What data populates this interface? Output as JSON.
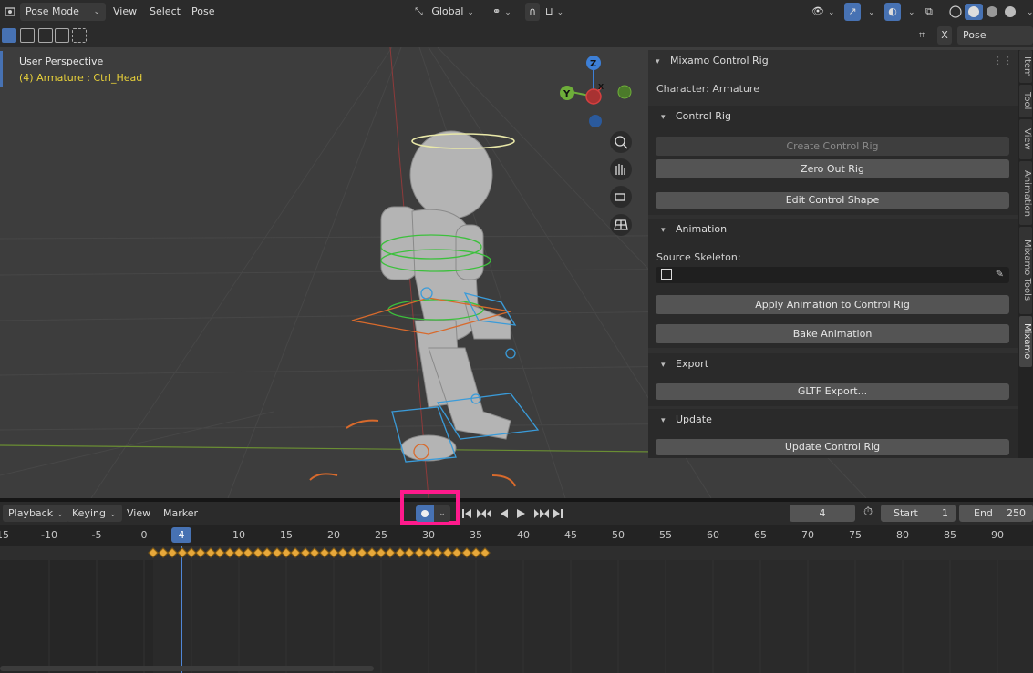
{
  "header": {
    "mode": "Pose Mode",
    "menus": [
      "View",
      "Select",
      "Pose"
    ],
    "orientation": "Global"
  },
  "toolbar": {
    "pose_options": "Pose Options",
    "x_label": "X"
  },
  "viewport": {
    "perspective": "User Perspective",
    "active_object": "(4) Armature : Ctrl_Head",
    "gizmo": {
      "z": "Z",
      "y": "Y",
      "x": "X"
    }
  },
  "panel": {
    "title": "Mixamo Control Rig",
    "character": "Character: Armature",
    "control_rig": {
      "title": "Control Rig",
      "create": "Create Control Rig",
      "zero_out": "Zero Out Rig",
      "edit_shape": "Edit Control Shape"
    },
    "animation": {
      "title": "Animation",
      "source_label": "Source Skeleton:",
      "apply": "Apply Animation to Control Rig",
      "bake": "Bake Animation"
    },
    "export": {
      "title": "Export",
      "gltf": "GLTF Export..."
    },
    "update": {
      "title": "Update",
      "update_rig": "Update Control Rig"
    }
  },
  "side_tabs": [
    "Item",
    "Tool",
    "View",
    "Animation",
    "Mixamo Tools",
    "Mixamo"
  ],
  "timeline": {
    "menus": [
      "Playback",
      "Keying",
      "View",
      "Marker"
    ],
    "current_frame": "4",
    "start_label": "Start",
    "start_value": "1",
    "end_label": "End",
    "end_value": "250",
    "ruler": [
      "15",
      "-10",
      "-5",
      "0",
      "10",
      "15",
      "20",
      "25",
      "30",
      "35",
      "40",
      "45",
      "50",
      "55",
      "60",
      "65",
      "70",
      "75",
      "80",
      "85",
      "90"
    ],
    "playhead_label": "4"
  },
  "colors": {
    "accent": "#4772b3",
    "highlight_box": "#ff1a8c",
    "keyframe": "#e8a93b",
    "active_text": "#e8d13a"
  }
}
